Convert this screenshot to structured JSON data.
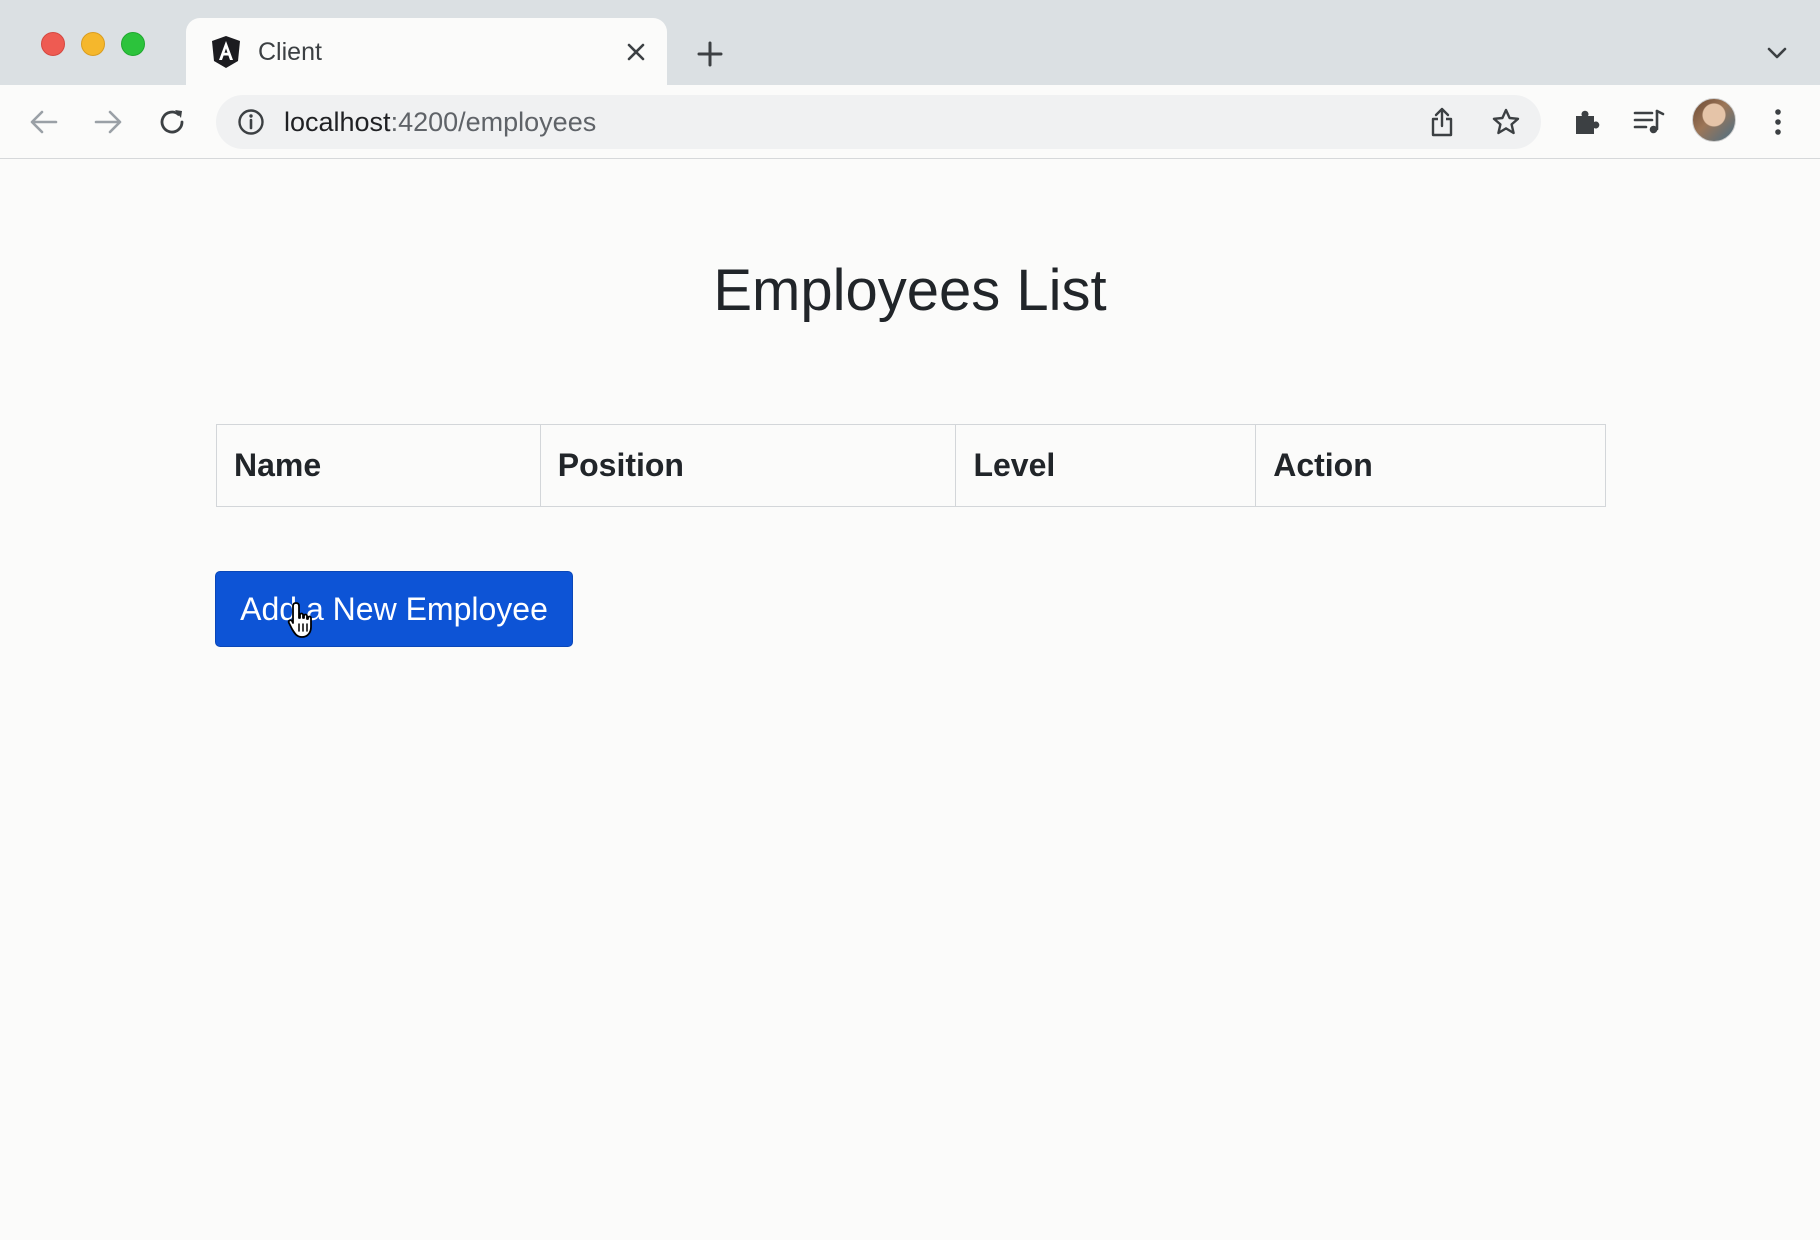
{
  "browser": {
    "tab": {
      "title": "Client",
      "favicon": "angular-icon"
    },
    "address_bar": {
      "host": "localhost",
      "path": ":4200/employees"
    },
    "icons": {
      "back": "arrow-left-icon",
      "forward": "arrow-right-icon",
      "reload": "reload-icon",
      "site_info": "info-icon",
      "share": "share-icon",
      "bookmark": "star-icon",
      "extensions": "puzzle-icon",
      "media": "media-queue-icon",
      "menu": "more-vert-icon",
      "new_tab": "plus-icon",
      "tab_search": "chevron-down-icon",
      "close_tab": "close-icon"
    }
  },
  "page": {
    "title": "Employees List",
    "table": {
      "columns": [
        "Name",
        "Position",
        "Level",
        "Action"
      ],
      "rows": []
    },
    "add_button": {
      "label": "Add a New Employee",
      "color": "#0d54d6"
    }
  }
}
